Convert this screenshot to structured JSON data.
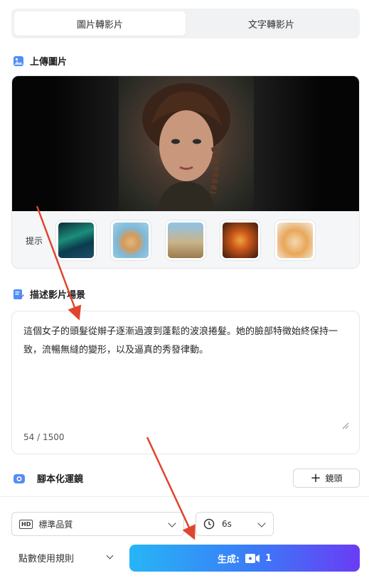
{
  "tabs": [
    {
      "label": "圖片轉影片",
      "active": true
    },
    {
      "label": "文字轉影片",
      "active": false
    }
  ],
  "upload": {
    "title": "上傳圖片",
    "hint_label": "提示",
    "thumbnails": [
      "aurora-thumbnail",
      "teddy-bear-thumbnail",
      "cyclist-thumbnail",
      "perfume-bottle-thumbnail",
      "kitten-thumbnail"
    ]
  },
  "description": {
    "title": "描述影片場景",
    "text": "這個女子的頭髮從辮子逐漸過渡到蓬鬆的波浪捲髮。她的臉部特徵始終保持一致，流暢無縫的變形，以及逼真的秀發律動。",
    "counter": "54 / 1500"
  },
  "script_lens": {
    "title": "腳本化運鏡",
    "add_button": "鏡頭"
  },
  "quality": {
    "badge": "HD",
    "label": "標準品質"
  },
  "duration": {
    "label": "6s"
  },
  "rules_label": "點數使用規則",
  "generate": {
    "label": "生成:",
    "count": "1"
  },
  "colors": {
    "accent_start": "#27b5f6",
    "accent_end": "#6a3cf5",
    "annotation_arrow": "#e0442e"
  }
}
